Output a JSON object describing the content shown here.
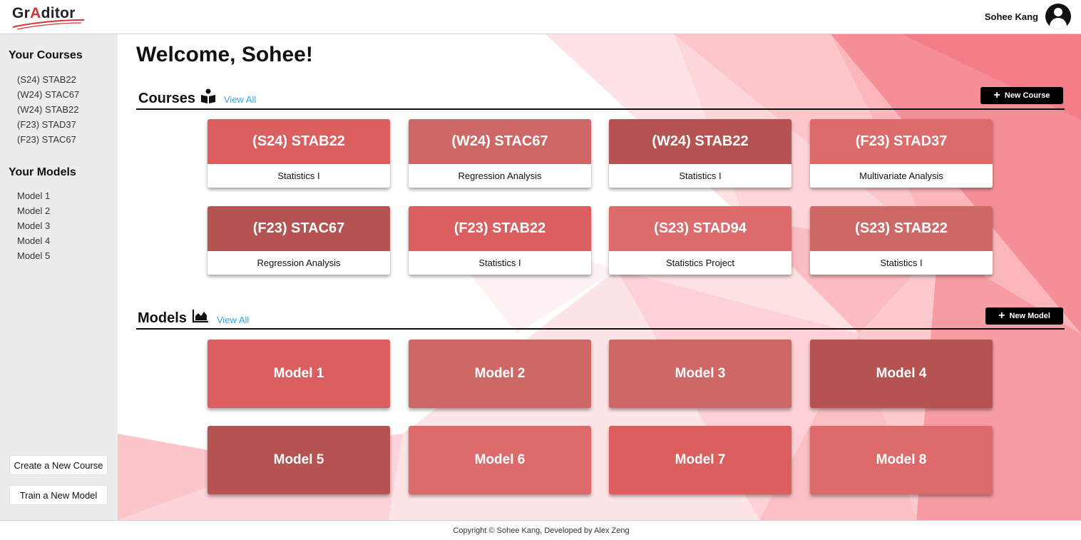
{
  "header": {
    "logo_text_pre": "Gr",
    "logo_text_mark": "A",
    "logo_text_post": "ditor",
    "user_name": "Sohee Kang"
  },
  "sidebar": {
    "courses_heading": "Your Courses",
    "courses": [
      "(S24) STAB22",
      "(W24) STAC67",
      "(W24) STAB22",
      "(F23) STAD37",
      "(F23) STAC67"
    ],
    "models_heading": "Your Models",
    "models": [
      "Model 1",
      "Model 2",
      "Model 3",
      "Model 4",
      "Model 5"
    ],
    "create_course_label": "Create a New Course",
    "train_model_label": "Train a New Model"
  },
  "main": {
    "welcome": "Welcome, Sohee!",
    "courses_section": {
      "title": "Courses",
      "view_all": "View All",
      "new_button": "New Course",
      "cards": [
        {
          "code": "(S24) STAB22",
          "name": "Statistics I",
          "color": "#dc5f60"
        },
        {
          "code": "(W24) STAC67",
          "name": "Regression Analysis",
          "color": "#cd6867"
        },
        {
          "code": "(W24) STAB22",
          "name": "Statistics I",
          "color": "#b55352"
        },
        {
          "code": "(F23) STAD37",
          "name": "Multivariate Analysis",
          "color": "#dd6b6b"
        },
        {
          "code": "(F23) STAC67",
          "name": "Regression Analysis",
          "color": "#b55352"
        },
        {
          "code": "(F23) STAB22",
          "name": "Statistics I",
          "color": "#dc5f60"
        },
        {
          "code": "(S23) STAD94",
          "name": "Statistics Project",
          "color": "#dd6b6b"
        },
        {
          "code": "(S23) STAB22",
          "name": "Statistics I",
          "color": "#cd6867"
        }
      ]
    },
    "models_section": {
      "title": "Models",
      "view_all": "View All",
      "new_button": "New Model",
      "cards": [
        {
          "name": "Model 1",
          "color": "#dc5f60"
        },
        {
          "name": "Model 2",
          "color": "#cd6867"
        },
        {
          "name": "Model 3",
          "color": "#cd6867"
        },
        {
          "name": "Model 4",
          "color": "#b55352"
        },
        {
          "name": "Model 5",
          "color": "#b55352"
        },
        {
          "name": "Model 6",
          "color": "#dd6b6b"
        },
        {
          "name": "Model 7",
          "color": "#dc5f60"
        },
        {
          "name": "Model 8",
          "color": "#dd6b6b"
        }
      ]
    }
  },
  "footer": {
    "copyright": "Copyright © Sohee Kang, Developed by Alex Zeng"
  },
  "colors": {
    "accent_link": "#2fa7e0",
    "sidebar_bg": "#ececec",
    "button_dark": "#000000"
  }
}
